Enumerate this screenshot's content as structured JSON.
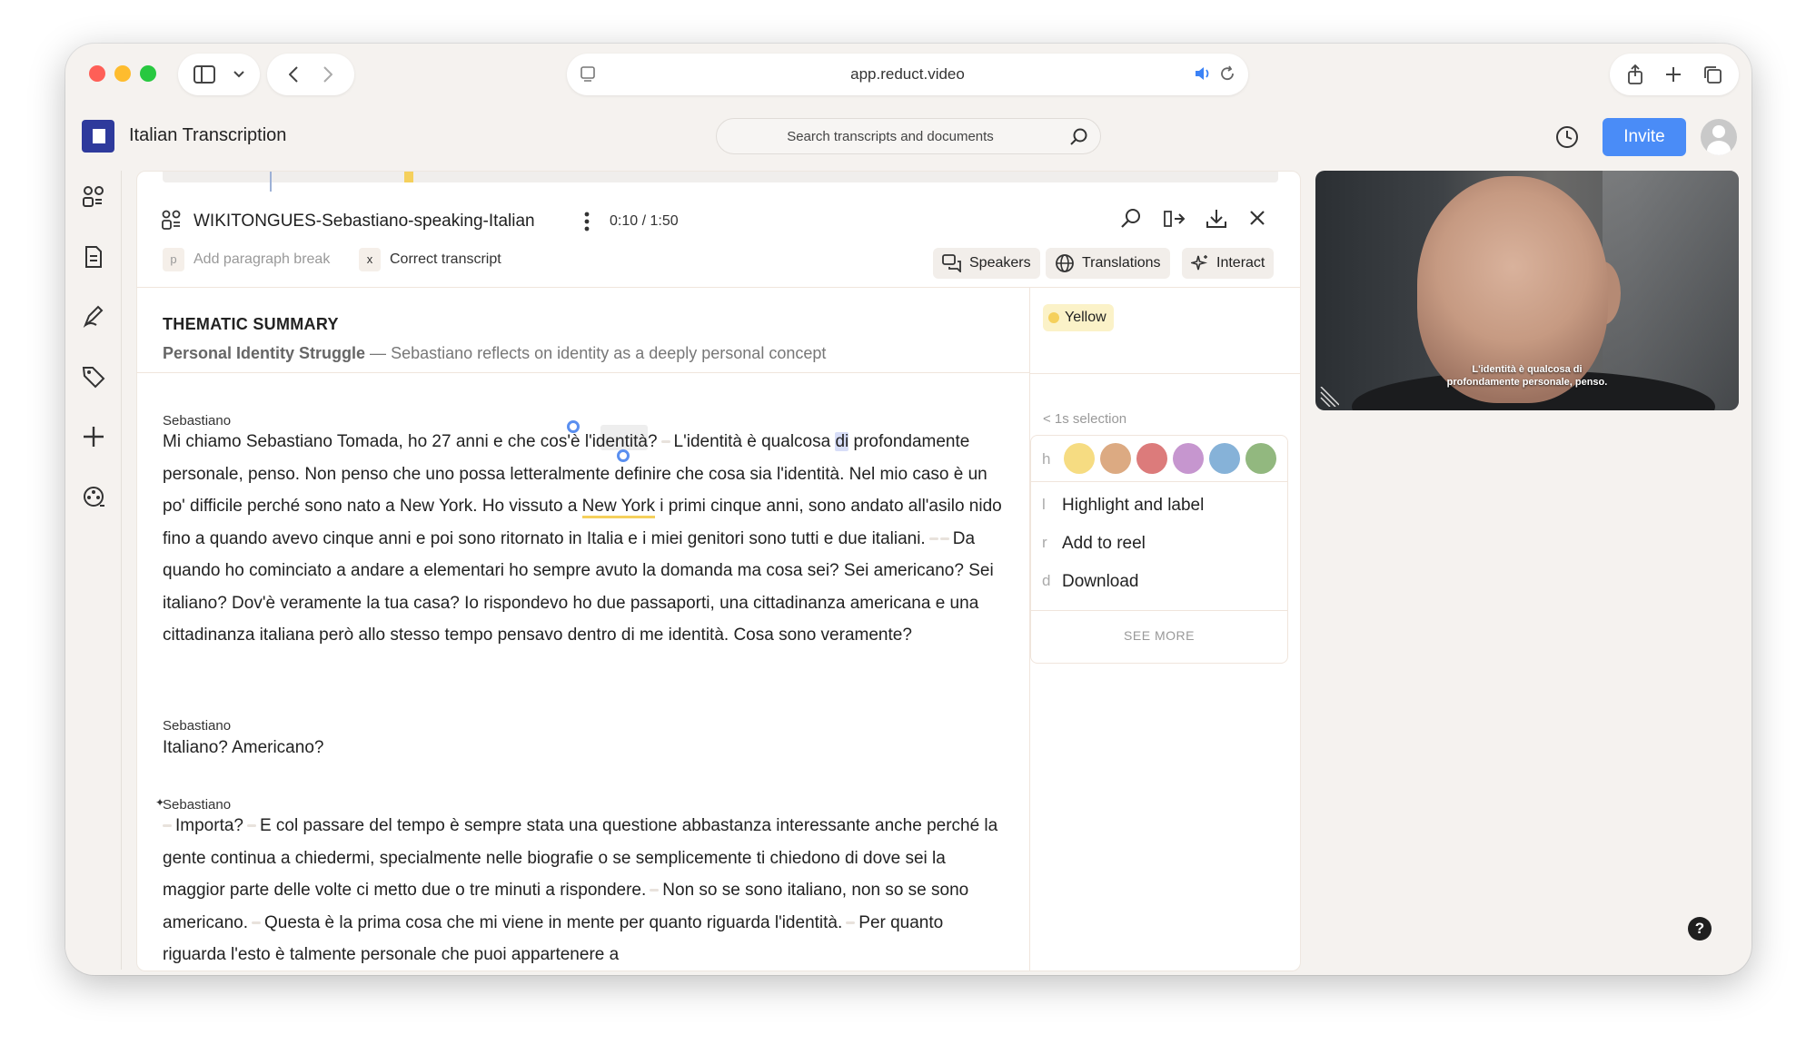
{
  "browser": {
    "url": "app.reduct.video"
  },
  "header": {
    "project_title": "Italian Transcription",
    "search_placeholder": "Search transcripts and documents",
    "invite_label": "Invite"
  },
  "document": {
    "name": "WIKITONGUES-Sebastiano-speaking-Italian",
    "timecode": "0:10 / 1:50",
    "toolbar": {
      "paragraph_key": "p",
      "paragraph_label": "Add paragraph break",
      "correct_key": "x",
      "correct_label": "Correct transcript",
      "speakers_label": "Speakers",
      "translations_label": "Translations",
      "interact_label": "Interact"
    },
    "summary": {
      "heading": "THEMATIC SUMMARY",
      "topic": "Personal Identity Struggle",
      "dash": " — ",
      "text": "Sebastiano reflects on identity as a deeply personal concept"
    }
  },
  "transcript": {
    "p1": {
      "speaker": "Sebastiano",
      "a": "Mi chiamo Sebastiano Tomada, ho 27 anni e che cos'è l'identità?",
      "b": "L'identità è qualcosa ",
      "sel": "di",
      "c": " profondamente personale, penso. Non penso che uno possa letteralmente definire che cosa sia l'identità. Nel mio caso è un po' difficile perché sono nato a New York. Ho vissuto a ",
      "ul": "New York",
      "d": " i primi cinque anni, sono andato all'asilo nido fino a quando avevo cinque anni e poi sono ritornato in Italia e i miei genitori sono tutti e due italiani.",
      "e": "Da quando ho cominciato a andare a elementari ho sempre avuto la domanda ma cosa sei? Sei americano? Sei italiano? Dov'è veramente la tua casa? Io rispondevo ho due passaporti, una cittadinanza americana e una cittadinanza italiana però allo stesso tempo pensavo dentro di me identità. Cosa sono veramente?"
    },
    "p2": {
      "speaker": "Sebastiano",
      "text": "Italiano? Americano?"
    },
    "p3": {
      "speaker": "Sebastiano",
      "a": "Importa?",
      "b": "E col passare del tempo è sempre stata una questione abbastanza interessante anche perché la gente continua a chiedermi, specialmente nelle biografie o se semplicemente ti chiedono di dove sei la maggior parte delle volte ci metto due o tre minuti a rispondere.",
      "c": "Non so se sono italiano, non so se sono americano.",
      "d": "Questa è la prima cosa che mi viene in mente per quanto riguarda l'identità.",
      "e": "Per quanto riguarda l'esto è talmente personale che puoi appartenere a"
    }
  },
  "side": {
    "tag_label": "Yellow",
    "selection_info": "< 1s selection",
    "hk_h": "h",
    "hk_l": "l",
    "hk_r": "r",
    "hk_d": "d",
    "highlight_label": "Highlight and label",
    "reel_label": "Add to reel",
    "download_label": "Download",
    "see_more": "SEE MORE",
    "swatch_colors": [
      "#f6dc82",
      "#dcaa82",
      "#dc7b7b",
      "#c696cf",
      "#86b2d8",
      "#92b87f"
    ]
  },
  "video": {
    "caption_line1": "L'identità è qualcosa di",
    "caption_line2": "profondamente personale, penso."
  },
  "help_label": "?"
}
